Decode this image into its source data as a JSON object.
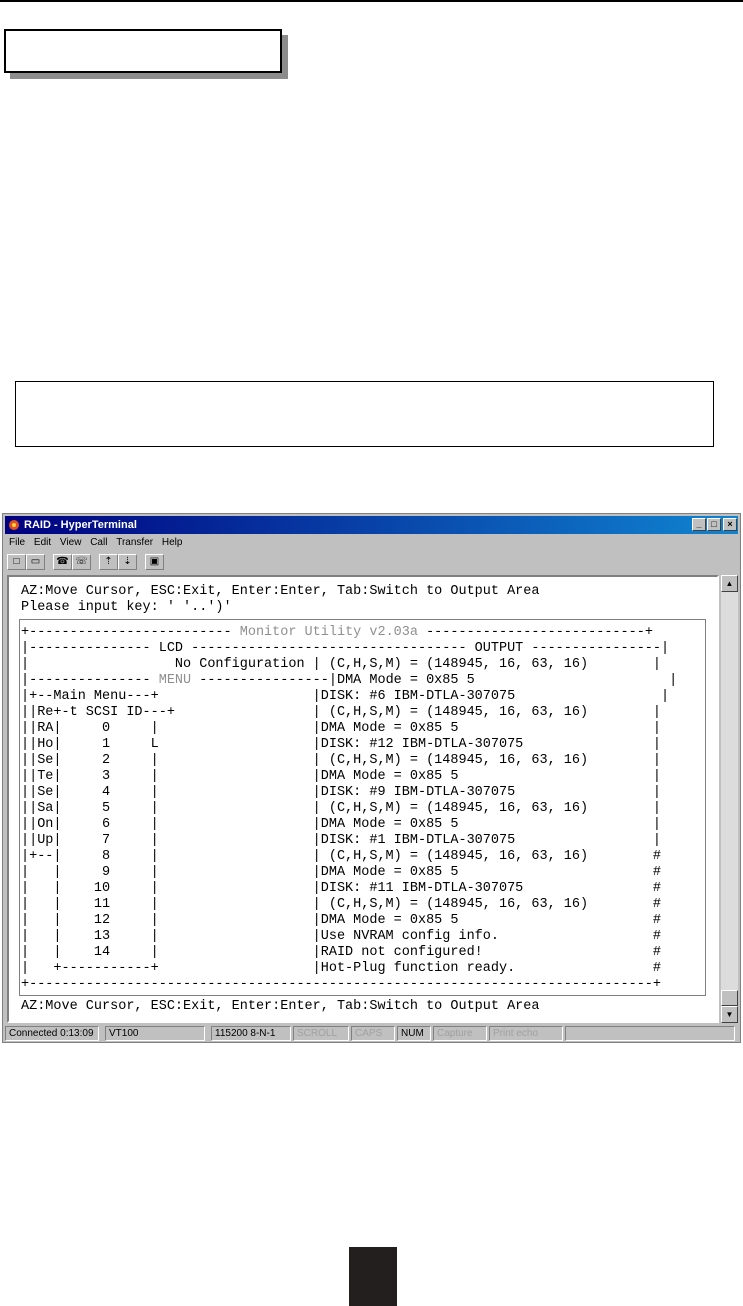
{
  "window": {
    "title": "RAID - HyperTerminal",
    "controls": [
      "_",
      "□",
      "×"
    ]
  },
  "menu": [
    "File",
    "Edit",
    "View",
    "Call",
    "Transfer",
    "Help"
  ],
  "toolbar_icons": [
    "new-icon",
    "open-icon",
    "phone-icon",
    "disconnect-icon",
    "send-icon",
    "receive-icon",
    "properties-icon"
  ],
  "terminal": {
    "line1": "AZ:Move Cursor, ESC:Exit, Enter:Enter, Tab:Switch to Output Area",
    "line2": "Please input key: ' '..')'",
    "header_left": "+------------------------- ",
    "header_title": "Monitor Utility v2.03a",
    "header_right": " ---------------------------+",
    "lcd_row": "|--------------- LCD ---------------------------------- OUTPUT ----------------|",
    "noconf_row": "|                  No Configuration | (C,H,S,M) = (148945, 16, 63, 16)        |",
    "menu_row_prefix": "|--------------- ",
    "menu_word": "MENU",
    "menu_row_suffix": " ----------------|DMA Mode = 0x85 5                        |",
    "rows": [
      "|+--Main Menu---+                   |DISK: #6 IBM-DTLA-307075                  |",
      "||Re+-t SCSI ID---+                 | (C,H,S,M) = (148945, 16, 63, 16)        |",
      "||RA|     0     |                   |DMA Mode = 0x85 5                        |",
      "||Ho|     1     L                   |DISK: #12 IBM-DTLA-307075                |",
      "||Se|     2     |                   | (C,H,S,M) = (148945, 16, 63, 16)        |",
      "||Te|     3     |                   |DMA Mode = 0x85 5                        |",
      "||Se|     4     |                   |DISK: #9 IBM-DTLA-307075                 |",
      "||Sa|     5     |                   | (C,H,S,M) = (148945, 16, 63, 16)        |",
      "||On|     6     |                   |DMA Mode = 0x85 5                        |",
      "||Up|     7     |                   |DISK: #1 IBM-DTLA-307075                 |",
      "|+--|     8     |                   | (C,H,S,M) = (148945, 16, 63, 16)        #",
      "|   |     9     |                   |DMA Mode = 0x85 5                        #",
      "|   |    10     |                   |DISK: #11 IBM-DTLA-307075                #",
      "|   |    11     |                   | (C,H,S,M) = (148945, 16, 63, 16)        #",
      "|   |    12     |                   |DMA Mode = 0x85 5                        #",
      "|   |    13     |                   |Use NVRAM config info.                   #",
      "|   |    14     |                   |RAID not configured!                     #",
      "|   +-----------+                   |Hot-Plug function ready.                 #",
      "+-----------------------------------------------------------------------------+"
    ],
    "footer": "AZ:Move Cursor, ESC:Exit, Enter:Enter, Tab:Switch to Output Area"
  },
  "status": {
    "connected": "Connected 0:13:09",
    "emulation": "VT100",
    "port": "115200 8-N-1",
    "scroll": "SCROLL",
    "caps": "CAPS",
    "num": "NUM",
    "capture": "Capture",
    "echo": "Print echo"
  }
}
